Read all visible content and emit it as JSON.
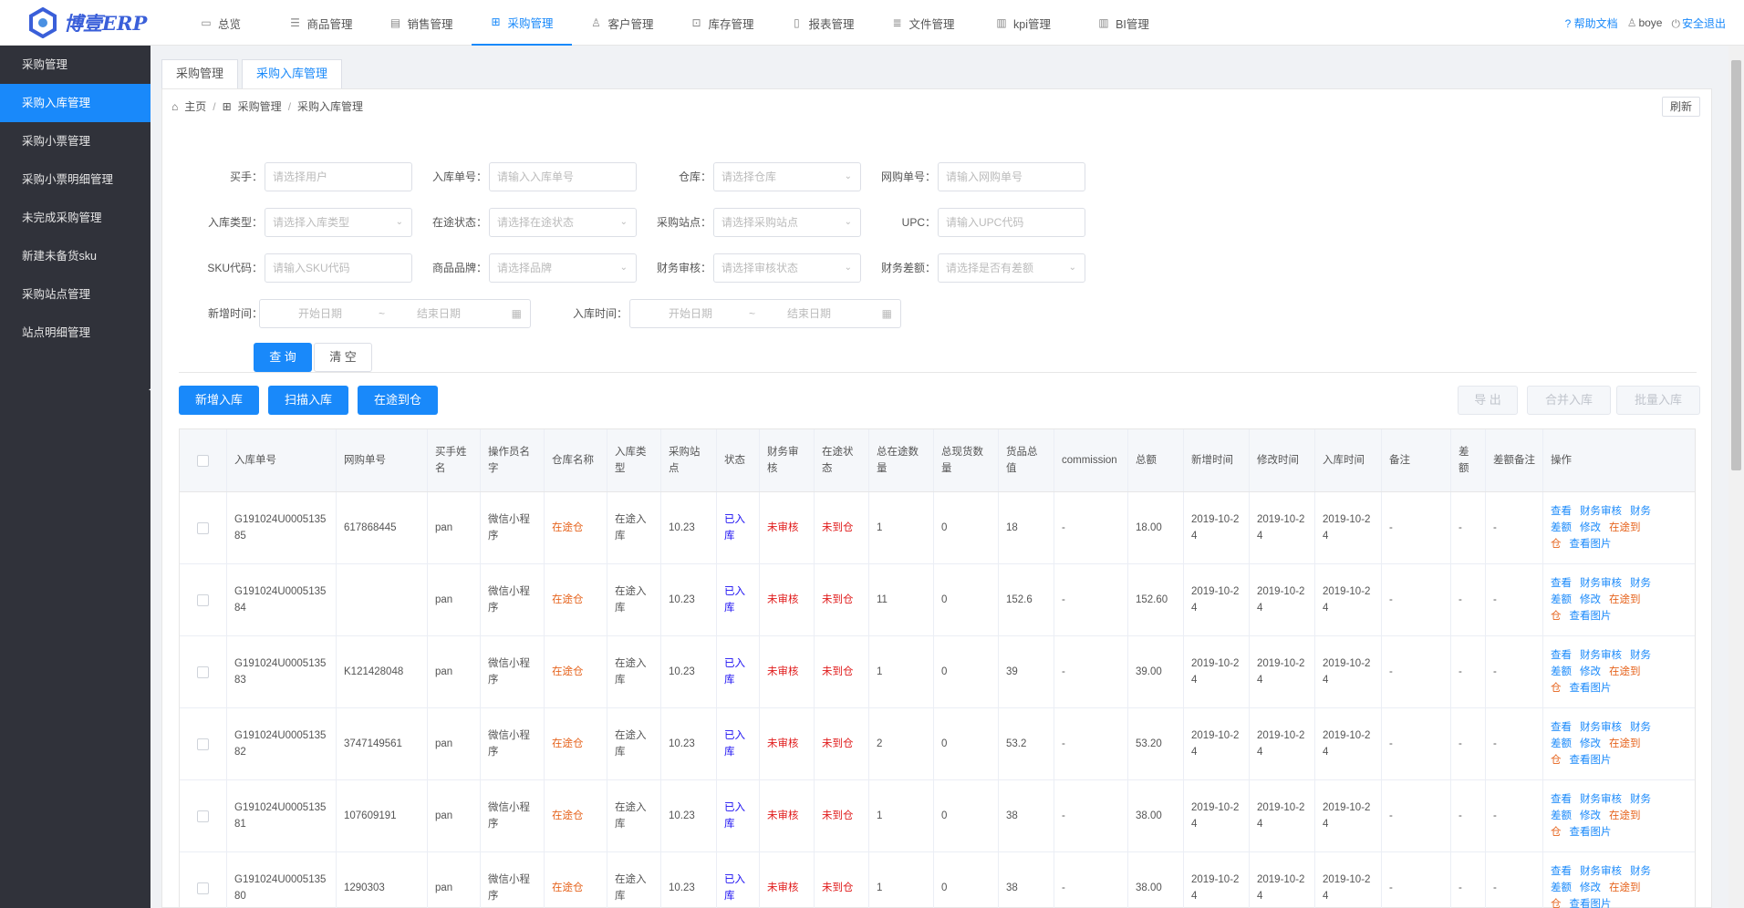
{
  "brand": {
    "text": "博壹ERP",
    "accent": "#1989fa"
  },
  "topnav": [
    {
      "label": "总览",
      "icon": "monitor-icon"
    },
    {
      "label": "商品管理",
      "icon": "list-icon"
    },
    {
      "label": "销售管理",
      "icon": "file-icon"
    },
    {
      "label": "采购管理",
      "icon": "grid-icon",
      "active": true
    },
    {
      "label": "客户管理",
      "icon": "user-icon"
    },
    {
      "label": "库存管理",
      "icon": "cart-icon"
    },
    {
      "label": "报表管理",
      "icon": "document-icon"
    },
    {
      "label": "文件管理",
      "icon": "doc-list-icon"
    },
    {
      "label": "kpi管理",
      "icon": "chart-icon"
    },
    {
      "label": "BI管理",
      "icon": "chart-icon"
    }
  ],
  "topright": {
    "help": "帮助文档",
    "user": "boye",
    "logout": "安全退出"
  },
  "sidebar": [
    {
      "label": "采购管理"
    },
    {
      "label": "采购入库管理",
      "active": true
    },
    {
      "label": "采购小票管理"
    },
    {
      "label": "采购小票明细管理"
    },
    {
      "label": "未完成采购管理"
    },
    {
      "label": "新建未备货sku"
    },
    {
      "label": "采购站点管理"
    },
    {
      "label": "站点明细管理"
    }
  ],
  "tabs": [
    {
      "label": "采购管理"
    },
    {
      "label": "采购入库管理",
      "active": true
    }
  ],
  "breadcrumb": {
    "home": "主页",
    "level1": "采购管理",
    "level2": "采购入库管理",
    "refresh": "刷新"
  },
  "filters": {
    "buyer": {
      "label": "买手：",
      "placeholder": "请选择用户"
    },
    "inbound_no": {
      "label": "入库单号：",
      "placeholder": "请输入入库单号"
    },
    "warehouse": {
      "label": "仓库：",
      "placeholder": "请选择仓库"
    },
    "purchase_no": {
      "label": "网购单号：",
      "placeholder": "请输入网购单号"
    },
    "inbound_type": {
      "label": "入库类型：",
      "placeholder": "请选择入库类型"
    },
    "transit_status": {
      "label": "在途状态：",
      "placeholder": "请选择在途状态"
    },
    "site": {
      "label": "采购站点：",
      "placeholder": "请选择采购站点"
    },
    "upc": {
      "label": "UPC：",
      "placeholder": "请输入UPC代码"
    },
    "sku": {
      "label": "SKU代码：",
      "placeholder": "请输入SKU代码"
    },
    "brand": {
      "label": "商品品牌：",
      "placeholder": "请选择品牌"
    },
    "finance_review": {
      "label": "财务审核：",
      "placeholder": "请选择审核状态"
    },
    "finance_diff": {
      "label": "财务差额：",
      "placeholder": "请选择是否有差额"
    },
    "created_time": {
      "label": "新增时间：",
      "start": "开始日期",
      "sep": "~",
      "end": "结束日期"
    },
    "inbound_time": {
      "label": "入库时间：",
      "start": "开始日期",
      "sep": "~",
      "end": "结束日期"
    },
    "search_btn": "查 询",
    "clear_btn": "清 空"
  },
  "actions": {
    "add": "新增入库",
    "scan": "扫描入库",
    "transit": "在途到仓",
    "export": "导 出",
    "merge": "合并入库",
    "batch": "批量入库"
  },
  "table": {
    "headers": [
      "入库单号",
      "网购单号",
      "买手姓名",
      "操作员名字",
      "仓库名称",
      "入库类型",
      "采购站点",
      "状态",
      "财务审核",
      "在途状态",
      "总在途数量",
      "总现货数量",
      "货品总值",
      "commission",
      "总额",
      "新增时间",
      "修改时间",
      "入库时间",
      "备注",
      "差额",
      "差额备注",
      "操作"
    ],
    "ops": [
      "查看",
      "财务审核",
      "财务差额",
      "修改",
      "在途到仓",
      "查看图片"
    ],
    "rows": [
      {
        "no": "G191024U000513585",
        "web": "617868445",
        "buyer": "pan",
        "operator": "微信小程序",
        "wh": "在途仓",
        "type": "在途入库",
        "site": "10.23",
        "status": "已入库",
        "review": "未审核",
        "transit": "未到仓",
        "t_qty": "1",
        "s_qty": "0",
        "value": "18",
        "comm": "-",
        "total": "18.00",
        "created": "2019-10-24",
        "modified": "2019-10-24",
        "inbound": "2019-10-24",
        "remark": "-",
        "diff": "-",
        "diff_remark": "-"
      },
      {
        "no": "G191024U000513584",
        "web": "",
        "buyer": "pan",
        "operator": "微信小程序",
        "wh": "在途仓",
        "type": "在途入库",
        "site": "10.23",
        "status": "已入库",
        "review": "未审核",
        "transit": "未到仓",
        "t_qty": "11",
        "s_qty": "0",
        "value": "152.6",
        "comm": "-",
        "total": "152.60",
        "created": "2019-10-24",
        "modified": "2019-10-24",
        "inbound": "2019-10-24",
        "remark": "-",
        "diff": "-",
        "diff_remark": "-"
      },
      {
        "no": "G191024U000513583",
        "web": "K121428048",
        "buyer": "pan",
        "operator": "微信小程序",
        "wh": "在途仓",
        "type": "在途入库",
        "site": "10.23",
        "status": "已入库",
        "review": "未审核",
        "transit": "未到仓",
        "t_qty": "1",
        "s_qty": "0",
        "value": "39",
        "comm": "-",
        "total": "39.00",
        "created": "2019-10-24",
        "modified": "2019-10-24",
        "inbound": "2019-10-24",
        "remark": "-",
        "diff": "-",
        "diff_remark": "-"
      },
      {
        "no": "G191024U000513582",
        "web": "3747149561",
        "buyer": "pan",
        "operator": "微信小程序",
        "wh": "在途仓",
        "type": "在途入库",
        "site": "10.23",
        "status": "已入库",
        "review": "未审核",
        "transit": "未到仓",
        "t_qty": "2",
        "s_qty": "0",
        "value": "53.2",
        "comm": "-",
        "total": "53.20",
        "created": "2019-10-24",
        "modified": "2019-10-24",
        "inbound": "2019-10-24",
        "remark": "-",
        "diff": "-",
        "diff_remark": "-"
      },
      {
        "no": "G191024U000513581",
        "web": "107609191",
        "buyer": "pan",
        "operator": "微信小程序",
        "wh": "在途仓",
        "type": "在途入库",
        "site": "10.23",
        "status": "已入库",
        "review": "未审核",
        "transit": "未到仓",
        "t_qty": "1",
        "s_qty": "0",
        "value": "38",
        "comm": "-",
        "total": "38.00",
        "created": "2019-10-24",
        "modified": "2019-10-24",
        "inbound": "2019-10-24",
        "remark": "-",
        "diff": "-",
        "diff_remark": "-"
      },
      {
        "no": "G191024U000513580",
        "web": "1290303",
        "buyer": "pan",
        "operator": "微信小程序",
        "wh": "在途仓",
        "type": "在途入库",
        "site": "10.23",
        "status": "已入库",
        "review": "未审核",
        "transit": "未到仓",
        "t_qty": "1",
        "s_qty": "0",
        "value": "38",
        "comm": "-",
        "total": "38.00",
        "created": "2019-10-24",
        "modified": "2019-10-24",
        "inbound": "2019-10-24",
        "remark": "-",
        "diff": "-",
        "diff_remark": "-"
      }
    ]
  }
}
